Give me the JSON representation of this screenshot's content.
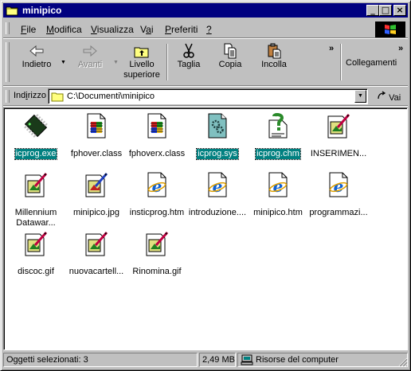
{
  "window": {
    "title": "minipico"
  },
  "menu": {
    "items": [
      {
        "pre": "",
        "accel": "F",
        "post": "ile"
      },
      {
        "pre": "",
        "accel": "M",
        "post": "odifica"
      },
      {
        "pre": "",
        "accel": "V",
        "post": "isualizza"
      },
      {
        "pre": "V",
        "accel": "a",
        "post": "i"
      },
      {
        "pre": "",
        "accel": "P",
        "post": "referiti"
      },
      {
        "pre": "",
        "accel": "?",
        "post": ""
      }
    ]
  },
  "toolbar": {
    "back": "Indietro",
    "forward": "Avanti",
    "up_line1": "Livello",
    "up_line2": "superiore",
    "cut": "Taglia",
    "copy": "Copia",
    "paste": "Incolla",
    "chevron": "»",
    "links": "Collegamenti"
  },
  "address": {
    "label_pre": "Ind",
    "label_accel": "i",
    "label_post": "rizzo",
    "value": "C:\\Documenti\\minipico",
    "go": "Vai"
  },
  "files": [
    {
      "name": "icprog.exe",
      "icon": "chip-icon",
      "selected": true
    },
    {
      "name": "fphover.class",
      "icon": "java-class-icon",
      "selected": false
    },
    {
      "name": "fphoverx.class",
      "icon": "java-class-icon",
      "selected": false
    },
    {
      "name": "icprog.sys",
      "icon": "system-file-icon",
      "selected": true
    },
    {
      "name": "icprog.chm",
      "icon": "help-file-icon",
      "selected": true
    },
    {
      "name": "INSERIMEN...",
      "icon": "image-file-icon",
      "selected": false
    },
    {
      "name": "Millennium\nDatawar...",
      "icon": "image-file-icon",
      "selected": false
    },
    {
      "name": "minipico.jpg",
      "icon": "jpg-file-icon",
      "selected": false
    },
    {
      "name": "insticprog.htm",
      "icon": "ie-document-icon",
      "selected": false
    },
    {
      "name": "introduzione....",
      "icon": "ie-document-icon",
      "selected": false
    },
    {
      "name": "minipico.htm",
      "icon": "ie-document-icon",
      "selected": false
    },
    {
      "name": "programmazi...",
      "icon": "ie-document-icon",
      "selected": false
    },
    {
      "name": "discoc.gif",
      "icon": "image-file-icon",
      "selected": false
    },
    {
      "name": "nuovacartell...",
      "icon": "image-file-icon",
      "selected": false
    },
    {
      "name": "Rinomina.gif",
      "icon": "image-file-icon",
      "selected": false
    }
  ],
  "status": {
    "selected": "Oggetti selezionati: 3",
    "size": "2,49 MB",
    "location": "Risorse del computer"
  },
  "colors": {
    "titlebar": "#000080",
    "selection": "#008080",
    "face": "#c0c0c0"
  }
}
